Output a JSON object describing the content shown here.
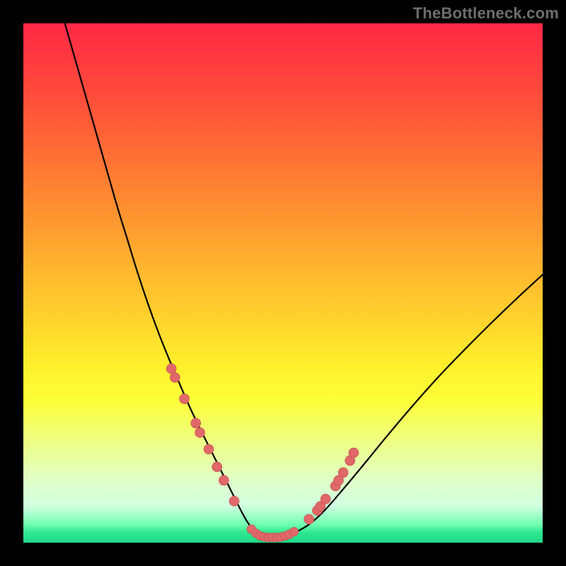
{
  "watermark": "TheBottleneck.com",
  "colors": {
    "background": "#000000",
    "curve_stroke": "#000000",
    "marker_fill": "#e06868",
    "marker_stroke": "#c04e4e"
  },
  "chart_data": {
    "type": "line",
    "title": "",
    "xlabel": "",
    "ylabel": "",
    "xlim": [
      0,
      100
    ],
    "ylim": [
      0,
      100
    ],
    "grid": false,
    "legend": false,
    "series": [
      {
        "name": "bottleneck-curve",
        "x": [
          8,
          10,
          12,
          14,
          16,
          18,
          20,
          22,
          24,
          26,
          28,
          30,
          32,
          34,
          36,
          37,
          38,
          39,
          40,
          41,
          42,
          43,
          44,
          45,
          46,
          47,
          48,
          50,
          52,
          55,
          58,
          62,
          66,
          70,
          75,
          80,
          85,
          90,
          95,
          100
        ],
        "y": [
          100,
          93,
          86,
          79,
          72,
          65,
          58.5,
          52,
          46,
          40.5,
          35.5,
          30.8,
          26.2,
          22,
          18,
          16,
          14,
          12,
          10,
          8,
          6,
          4.2,
          2.8,
          1.8,
          1.2,
          1,
          1,
          1,
          1.8,
          3.5,
          6.2,
          10.8,
          15.6,
          20.5,
          26.4,
          32,
          37.2,
          42.2,
          47,
          51.6
        ]
      }
    ],
    "curve_markers": {
      "left_descent": [
        {
          "x": 28.5,
          "y": 33.5
        },
        {
          "x": 29.2,
          "y": 31.8
        },
        {
          "x": 31.0,
          "y": 27.7
        },
        {
          "x": 33.2,
          "y": 23.0
        },
        {
          "x": 34.0,
          "y": 21.2
        },
        {
          "x": 35.7,
          "y": 18.0
        },
        {
          "x": 37.3,
          "y": 14.6
        },
        {
          "x": 38.6,
          "y": 12.0
        },
        {
          "x": 40.6,
          "y": 8.0
        }
      ],
      "valley_floor": [
        {
          "x": 43.9,
          "y": 2.6
        },
        {
          "x": 44.8,
          "y": 1.8
        },
        {
          "x": 45.6,
          "y": 1.3
        },
        {
          "x": 46.4,
          "y": 1.1
        },
        {
          "x": 47.2,
          "y": 1.0
        },
        {
          "x": 48.0,
          "y": 1.0
        },
        {
          "x": 48.8,
          "y": 1.0
        },
        {
          "x": 49.6,
          "y": 1.1
        },
        {
          "x": 50.4,
          "y": 1.3
        },
        {
          "x": 51.2,
          "y": 1.6
        },
        {
          "x": 52.1,
          "y": 2.1
        }
      ],
      "right_ascent": [
        {
          "x": 55.0,
          "y": 4.5
        },
        {
          "x": 56.6,
          "y": 6.2
        },
        {
          "x": 57.2,
          "y": 7.0
        },
        {
          "x": 58.2,
          "y": 8.4
        },
        {
          "x": 60.1,
          "y": 10.9
        },
        {
          "x": 60.7,
          "y": 12.0
        },
        {
          "x": 61.6,
          "y": 13.5
        },
        {
          "x": 62.9,
          "y": 15.8
        },
        {
          "x": 63.6,
          "y": 17.3
        }
      ]
    }
  }
}
